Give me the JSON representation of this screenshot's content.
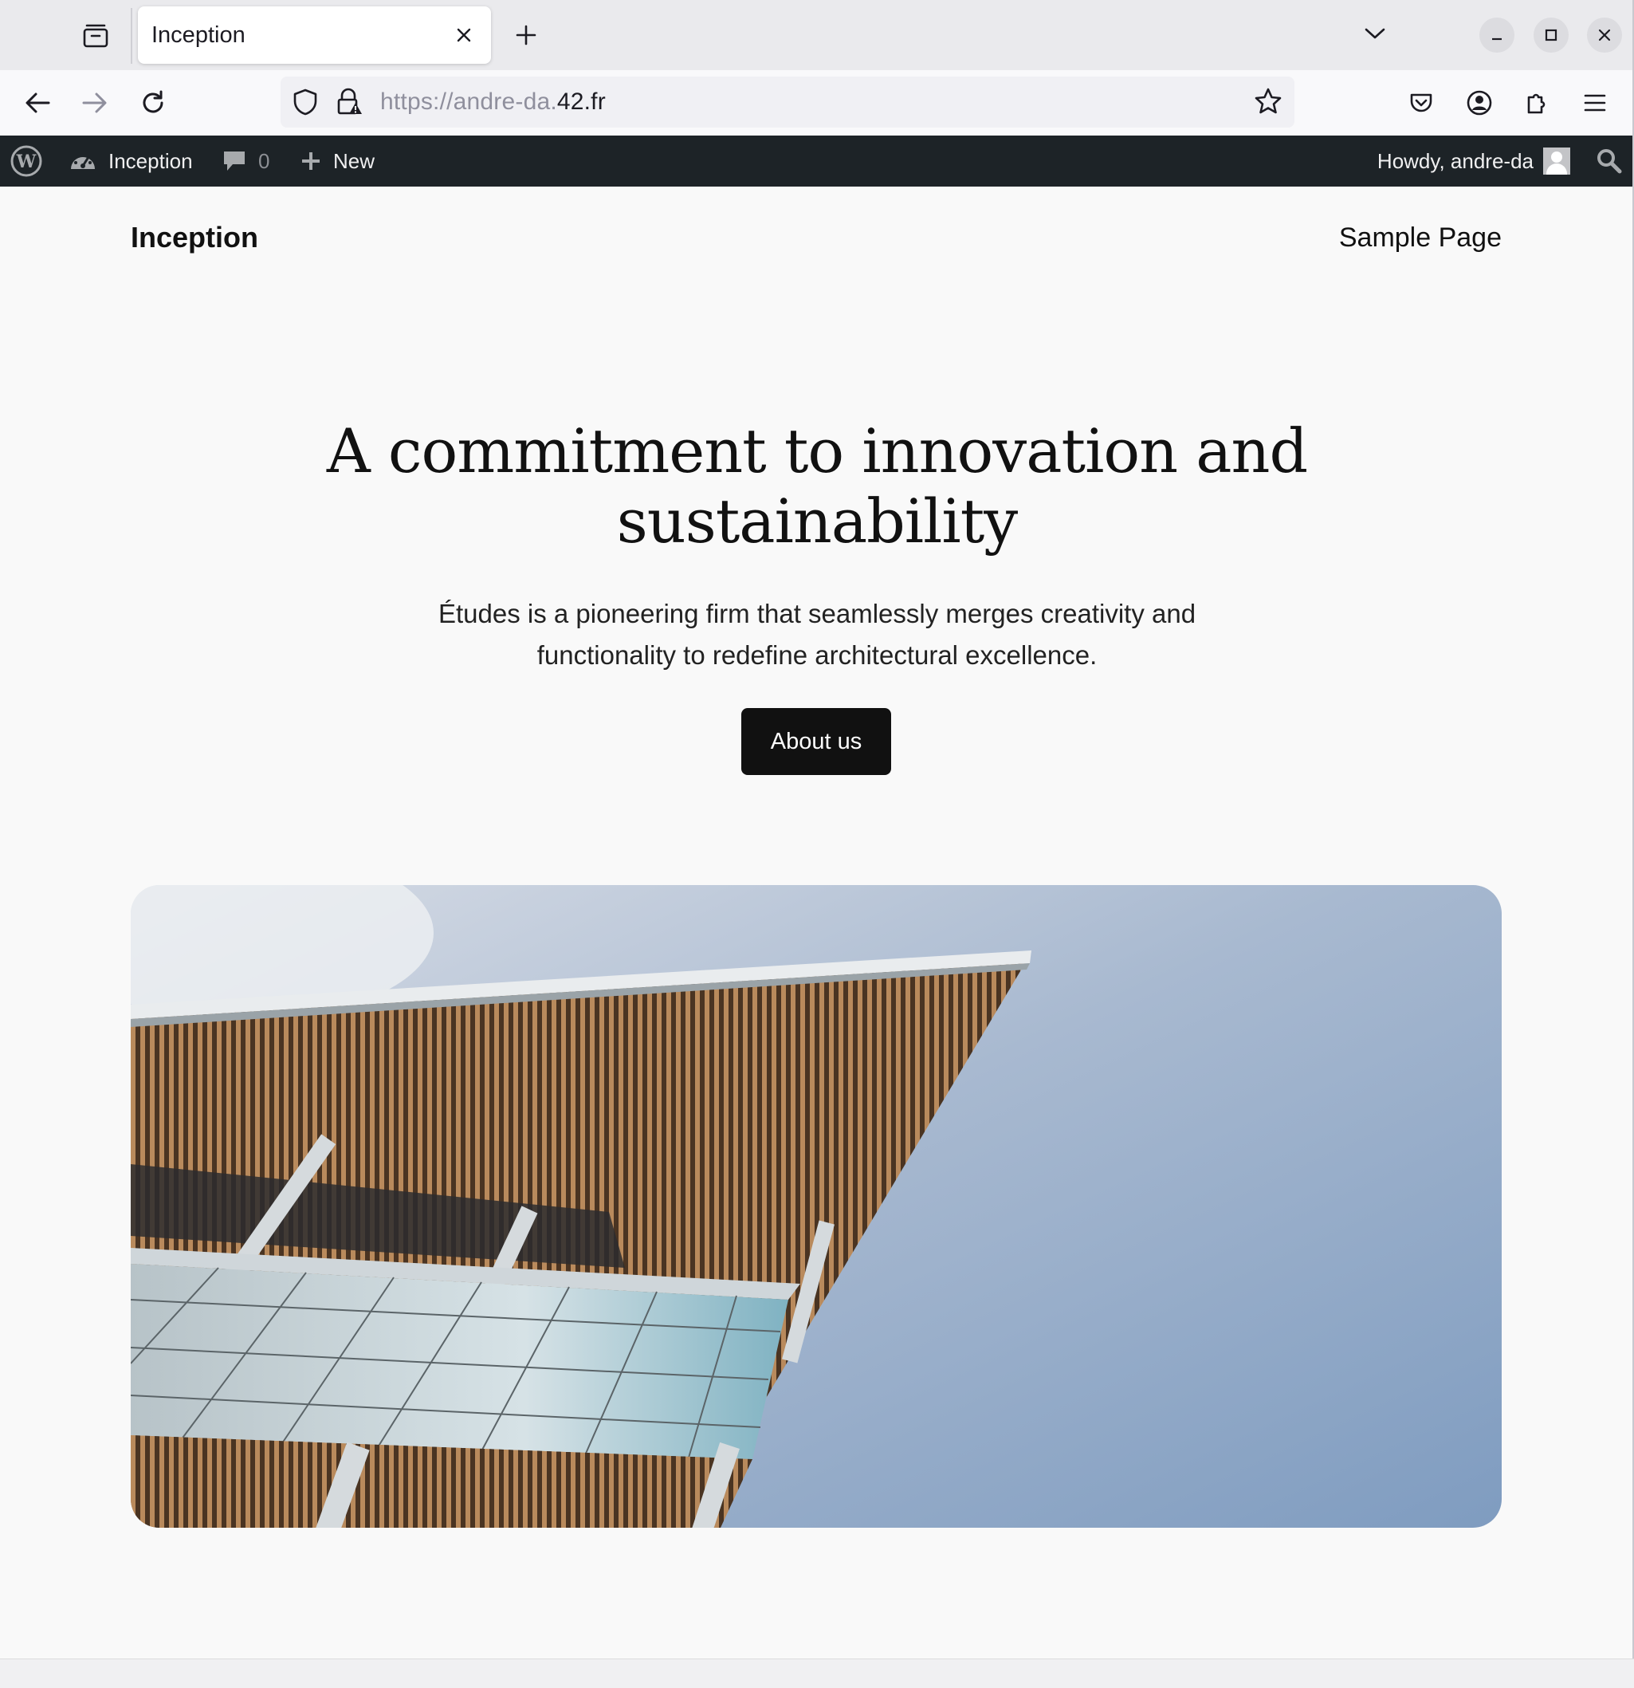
{
  "browser": {
    "tab_title": "Inception",
    "url": {
      "prefix": "https://andre-da.",
      "domain": "42.fr"
    }
  },
  "admin_bar": {
    "site_name": "Inception",
    "comments_count": "0",
    "new_label": "New",
    "greeting": "Howdy, andre-da"
  },
  "site": {
    "title": "Inception",
    "nav": [
      "Sample Page"
    ]
  },
  "hero": {
    "heading_line1": "A commitment to innovation and",
    "heading_line2": "sustainability",
    "text_line1": "Études is a pioneering firm that seamlessly merges creativity and",
    "text_line2": "functionality to redefine architectural excellence.",
    "button_label": "About us"
  },
  "colors": {
    "admin_bar_bg": "#1d2327",
    "page_bg": "#f9f9f9",
    "button_bg": "#111111"
  }
}
